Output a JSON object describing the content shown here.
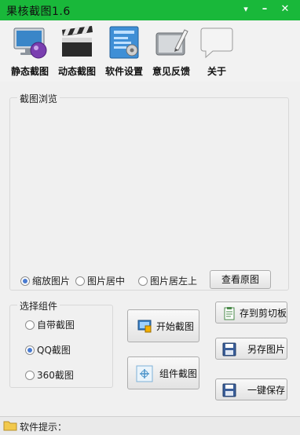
{
  "window": {
    "title": "果核截图1.6"
  },
  "toolbar": {
    "static_shot": "静态截图",
    "dynamic_shot": "动态截图",
    "settings": "软件设置",
    "feedback": "意见反馈",
    "about": "关于"
  },
  "preview": {
    "caption": "截图浏览",
    "options": [
      "缩放图片",
      "图片居中",
      "图片居左上"
    ],
    "selected": "缩放图片",
    "view_original": "查看原图"
  },
  "components": {
    "caption": "选择组件",
    "options": [
      "自带截图",
      "QQ截图",
      "360截图"
    ],
    "selected": "QQ截图"
  },
  "actions": {
    "start_shot": "开始截图",
    "component_shot": "组件截图",
    "copy_clipboard": "存到剪切板",
    "save_as": "另存图片",
    "one_key_save": "一键保存"
  },
  "status": {
    "label": "软件提示："
  },
  "colors": {
    "titlebar": "#19b83a",
    "panel": "#f0f0f0",
    "radio_accent": "#4a7bd0"
  }
}
